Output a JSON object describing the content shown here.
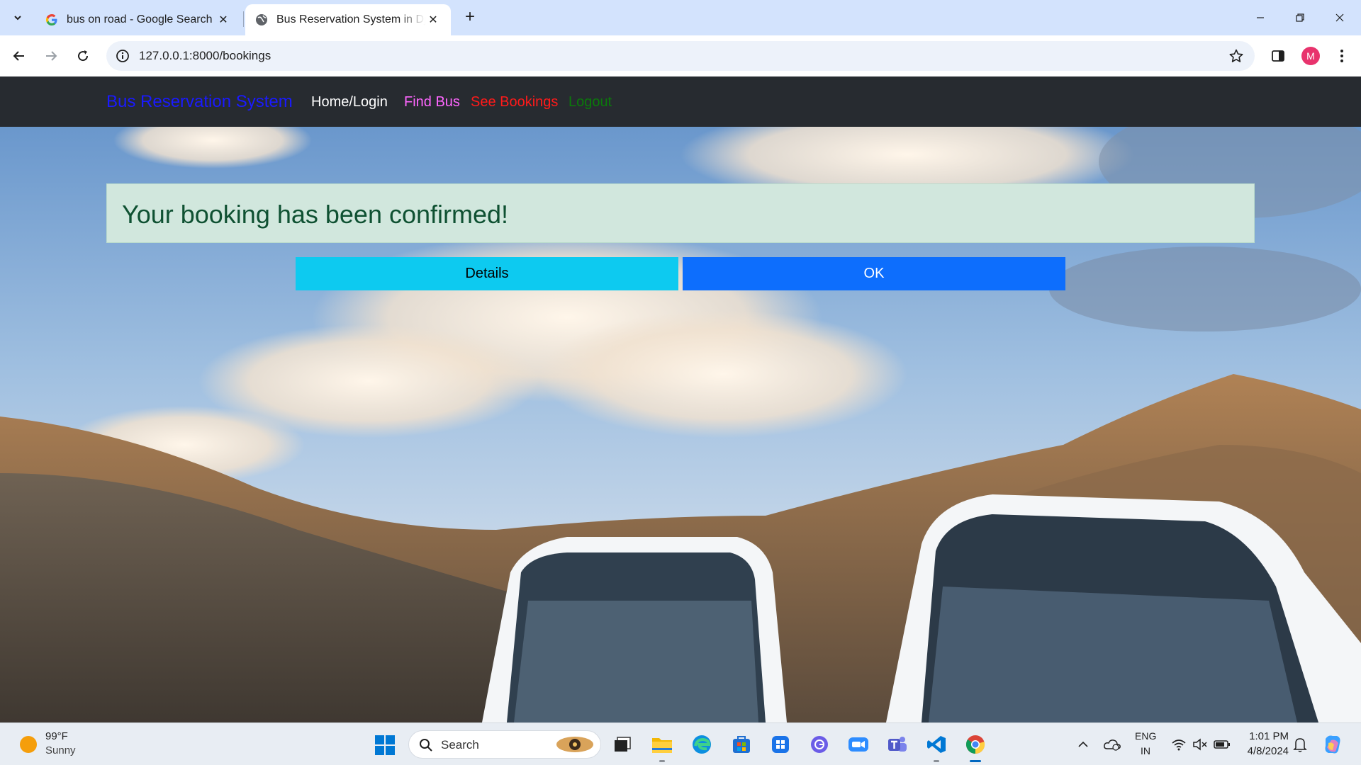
{
  "browser": {
    "tabs": [
      {
        "title": "bus on road - Google Search",
        "favicon": "google-g-icon",
        "active": false
      },
      {
        "title": "Bus Reservation System in Django",
        "favicon": "globe-icon",
        "active": true
      }
    ],
    "url": "127.0.0.1:8000/bookings",
    "profile_initial": "M"
  },
  "site": {
    "brand": "Bus Reservation System",
    "nav": {
      "home": "Home/Login",
      "find_bus": "Find Bus",
      "see_bookings": "See Bookings",
      "logout": "Logout"
    },
    "alert": {
      "message": "Your booking has been confirmed!"
    },
    "buttons": {
      "details": "Details",
      "ok": "OK"
    },
    "colors": {
      "brand": "#1a1aff",
      "nav_home": "#ffffff",
      "nav_find_bus": "#ff66ff",
      "nav_see_bookings": "#ff1a1a",
      "nav_logout": "#0a7a0a",
      "alert_bg": "#d1e7dd",
      "details_btn": "#0dcaf0",
      "ok_btn": "#0d6efd"
    }
  },
  "taskbar": {
    "weather": {
      "temp": "99°F",
      "condition": "Sunny"
    },
    "search_label": "Search",
    "apps": [
      "task-view-icon",
      "file-explorer-icon",
      "edge-icon",
      "store-icon",
      "app-icon",
      "app-icon",
      "zoom-icon",
      "teams-icon",
      "vscode-icon",
      "chrome-icon"
    ],
    "language": {
      "line1": "ENG",
      "line2": "IN"
    },
    "time": "1:01 PM",
    "date": "4/8/2024"
  }
}
